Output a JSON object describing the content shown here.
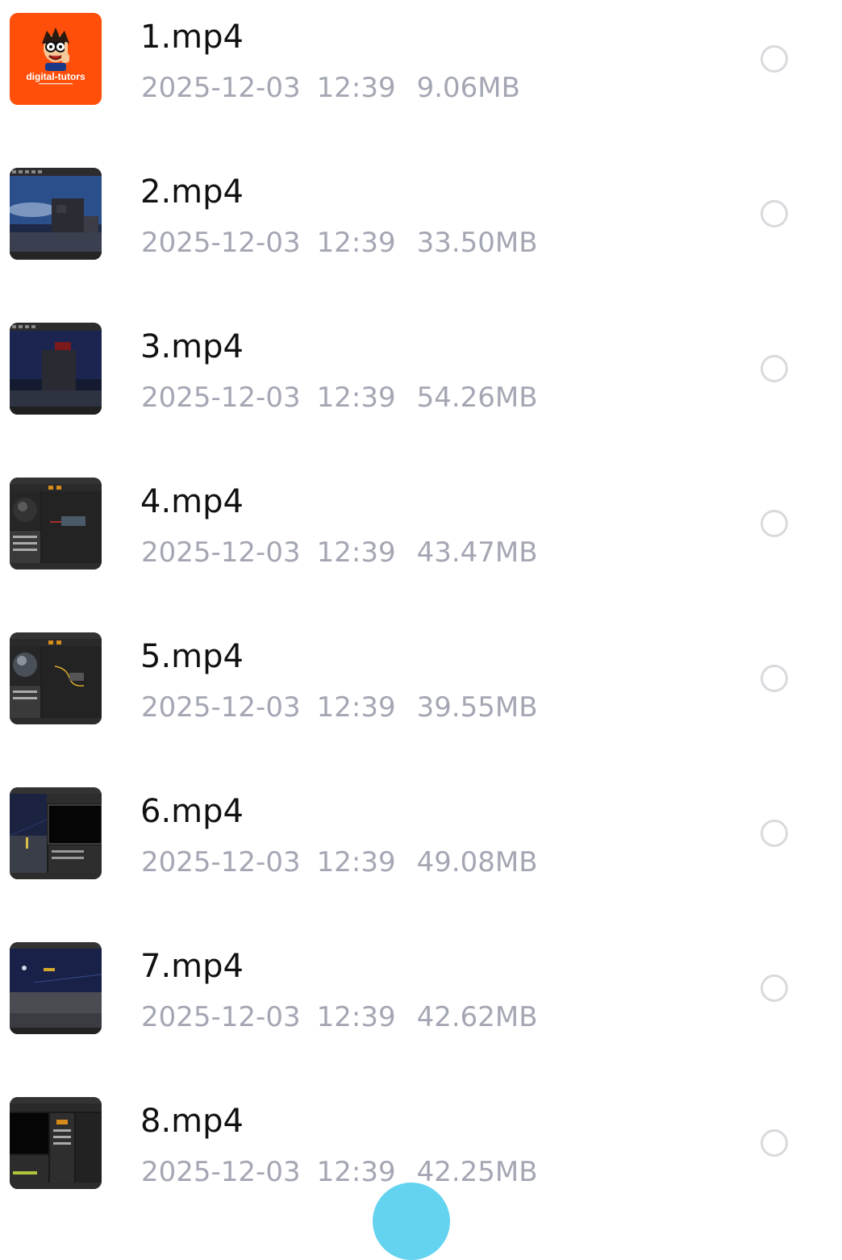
{
  "files": [
    {
      "name": "1.mp4",
      "date": "2025-12-03",
      "time": "12:39",
      "size": "9.06MB",
      "thumbnail": "orange-logo",
      "selected": false
    },
    {
      "name": "2.mp4",
      "date": "2025-12-03",
      "time": "12:39",
      "size": "33.50MB",
      "thumbnail": "night-scene",
      "selected": false
    },
    {
      "name": "3.mp4",
      "date": "2025-12-03",
      "time": "12:39",
      "size": "54.26MB",
      "thumbnail": "night-scene",
      "selected": false
    },
    {
      "name": "4.mp4",
      "date": "2025-12-03",
      "time": "12:39",
      "size": "43.47MB",
      "thumbnail": "editor-material",
      "selected": false
    },
    {
      "name": "5.mp4",
      "date": "2025-12-03",
      "time": "12:39",
      "size": "39.55MB",
      "thumbnail": "editor-material",
      "selected": false
    },
    {
      "name": "6.mp4",
      "date": "2025-12-03",
      "time": "12:39",
      "size": "49.08MB",
      "thumbnail": "editor-viewport",
      "selected": false
    },
    {
      "name": "7.mp4",
      "date": "2025-12-03",
      "time": "12:39",
      "size": "42.62MB",
      "thumbnail": "night-scene",
      "selected": false
    },
    {
      "name": "8.mp4",
      "date": "2025-12-03",
      "time": "12:39",
      "size": "42.25MB",
      "thumbnail": "editor-dark",
      "selected": false
    }
  ],
  "thumbnail_logo_text": "digital-tutors",
  "colors": {
    "name_text": "#111111",
    "meta_text": "#a4a7b3",
    "radio_border": "#d9d9de",
    "fab": "#64d3ef",
    "thumb_orange": "#ff4f0a"
  },
  "icons": {
    "radio": "radio-unchecked-icon",
    "fab": "fab-button"
  }
}
